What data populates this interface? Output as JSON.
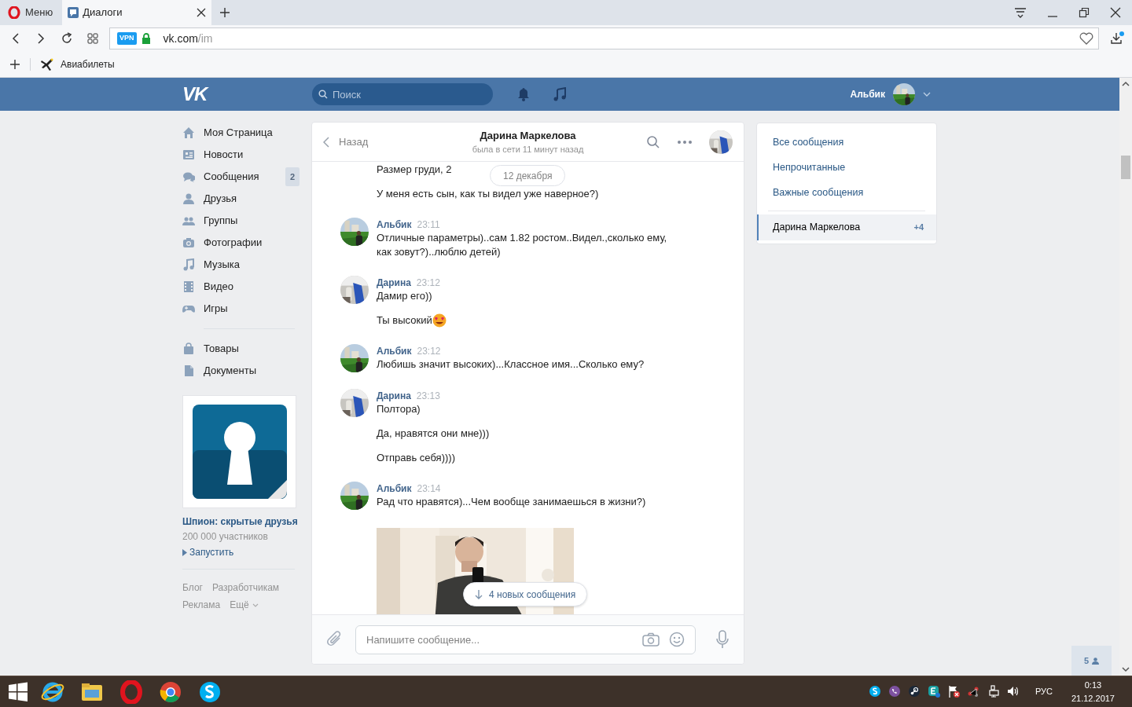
{
  "browser": {
    "menu_button": {
      "label": "Меню"
    },
    "tabs": [
      {
        "label": "Диалоги",
        "selected": true
      }
    ],
    "address": {
      "vpn_badge": "VPN",
      "host": "vk.com",
      "path": "/im"
    },
    "bookmarks": [
      {
        "label": "Авиабилеты"
      }
    ]
  },
  "header": {
    "logo": "VK",
    "search": {
      "placeholder": "Поиск"
    },
    "user_name": "Альбик"
  },
  "sidebar": {
    "items": [
      {
        "kind": "home",
        "label": "Моя Страница"
      },
      {
        "kind": "news",
        "label": "Новости"
      },
      {
        "kind": "chat",
        "label": "Сообщения",
        "badge": "2"
      },
      {
        "kind": "person",
        "label": "Друзья"
      },
      {
        "kind": "people",
        "label": "Группы"
      },
      {
        "kind": "camera",
        "label": "Фотографии"
      },
      {
        "kind": "note",
        "label": "Музыка"
      },
      {
        "kind": "film",
        "label": "Видео"
      },
      {
        "kind": "gamepad",
        "label": "Игры"
      }
    ],
    "items_2": [
      {
        "kind": "bag",
        "label": "Товары"
      },
      {
        "kind": "doc",
        "label": "Документы"
      }
    ],
    "ad": {
      "title": "Шпион: скрытые друзья",
      "members": "200 000 участников",
      "action": "Запустить"
    },
    "footer_links": [
      "Блог",
      "Разработчикам",
      "Реклама",
      "Ещё"
    ]
  },
  "chat": {
    "back": "Назад",
    "name": "Дарина Маркелова",
    "status": "была в сети 11 минут назад",
    "date_pill": "12 декабря",
    "groups": [
      {
        "messages": [
          {
            "text": "Размер груди, 2"
          },
          {
            "text": "У меня есть сын, как ты видел уже наверное?)"
          }
        ]
      },
      {
        "sender": "Альбик",
        "avatar": {
          "kind": "field"
        },
        "time": "23:11",
        "messages": [
          {
            "text": "Отличные параметры)..сам 1.82 ростом..Видел.,сколько ему, как зовут?)..люблю детей)"
          }
        ]
      },
      {
        "sender": "Дарина",
        "avatar": {
          "kind": "blue"
        },
        "time": "23:12",
        "messages": [
          {
            "text": "Дамир его))"
          },
          {
            "text": "Ты высокий",
            "emoji": {
              "kind": "heart_eyes"
            }
          }
        ]
      },
      {
        "sender": "Альбик",
        "avatar": {
          "kind": "field"
        },
        "time": "23:12",
        "messages": [
          {
            "text": "Любишь значит высоких)...Классное имя...Сколько ему?"
          }
        ]
      },
      {
        "sender": "Дарина",
        "avatar": {
          "kind": "blue"
        },
        "time": "23:13",
        "messages": [
          {
            "text": "Полтора)"
          },
          {
            "text": "Да, нравятся они мне)))"
          },
          {
            "text": "Отправь себя))))"
          }
        ]
      },
      {
        "sender": "Альбик",
        "avatar": {
          "kind": "field"
        },
        "time": "23:14",
        "messages": [
          {
            "text": "Рад что нравятся)...Чем вообще занимаешься в жизни?)"
          },
          {
            "kind": "picture"
          }
        ]
      }
    ],
    "new_messages": "4 новых сообщения",
    "input": {
      "placeholder": "Напишите сообщение..."
    }
  },
  "right_panel": {
    "items": [
      {
        "label": "Все сообщения",
        "selected": false
      },
      {
        "label": "Непрочитанные",
        "selected": false
      },
      {
        "label": "Важные сообщения",
        "selected": false
      },
      {
        "label": "Дарина Маркелова",
        "count": "+4",
        "selected": true
      }
    ]
  },
  "online_counter": "5",
  "taskbar": {
    "apps": [
      {
        "kind": "ie"
      },
      {
        "kind": "explorer"
      },
      {
        "kind": "opera"
      },
      {
        "kind": "chrome"
      },
      {
        "kind": "skype"
      }
    ],
    "tray": [
      {
        "kind": "skype"
      },
      {
        "kind": "viber"
      },
      {
        "kind": "steam"
      },
      {
        "kind": "edit"
      },
      {
        "kind": "flag"
      },
      {
        "kind": "network_app"
      },
      {
        "kind": "network"
      },
      {
        "kind": "volume"
      }
    ],
    "language": "РУС",
    "time": "0:13",
    "date": "21.12.2017"
  }
}
